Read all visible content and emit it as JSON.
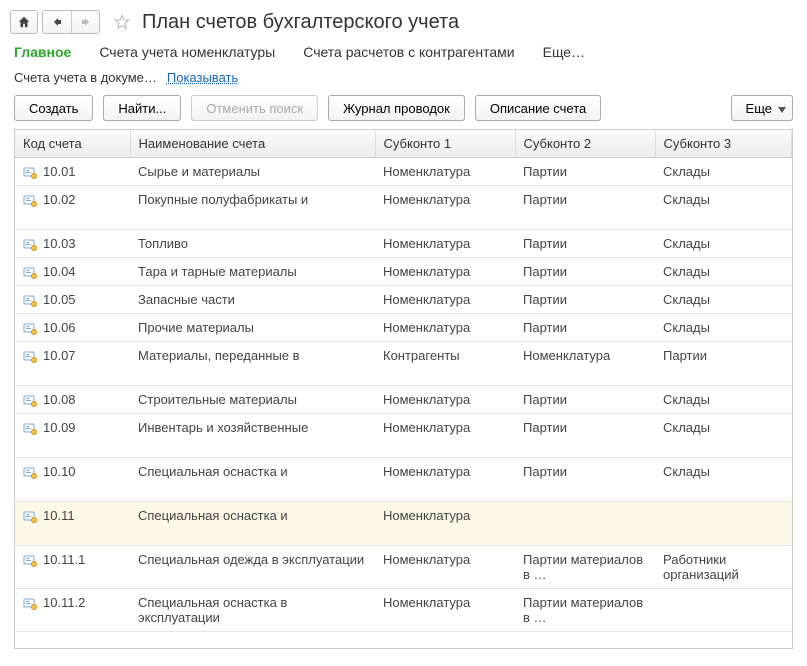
{
  "header": {
    "title": "План счетов бухгалтерского учета"
  },
  "tabs": {
    "main": "Главное",
    "nomenclature": "Счета учета номенклатуры",
    "contractors": "Счета расчетов с контрагентами",
    "more": "Еще…"
  },
  "filter": {
    "label": "Счета учета в докуме…",
    "link": "Показывать"
  },
  "toolbar": {
    "create": "Создать",
    "find": "Найти...",
    "cancel_search": "Отменить поиск",
    "journal": "Журнал проводок",
    "description": "Описание счета",
    "more": "Еще"
  },
  "columns": {
    "code": "Код счета",
    "name": "Наименование счета",
    "s1": "Субконто 1",
    "s2": "Субконто 2",
    "s3": "Субконто 3"
  },
  "rows": [
    {
      "code": "10.01",
      "name": "Сырье и материалы",
      "s1": "Номенклатура",
      "s2": "Партии",
      "s3": "Склады",
      "tall": false,
      "sel": false
    },
    {
      "code": "10.02",
      "name": "Покупные полуфабрикаты и",
      "s1": "Номенклатура",
      "s2": "Партии",
      "s3": "Склады",
      "tall": true,
      "sel": false
    },
    {
      "code": "10.03",
      "name": "Топливо",
      "s1": "Номенклатура",
      "s2": "Партии",
      "s3": "Склады",
      "tall": false,
      "sel": false
    },
    {
      "code": "10.04",
      "name": "Тара и тарные материалы",
      "s1": "Номенклатура",
      "s2": "Партии",
      "s3": "Склады",
      "tall": false,
      "sel": false
    },
    {
      "code": "10.05",
      "name": "Запасные части",
      "s1": "Номенклатура",
      "s2": "Партии",
      "s3": "Склады",
      "tall": false,
      "sel": false
    },
    {
      "code": "10.06",
      "name": "Прочие материалы",
      "s1": "Номенклатура",
      "s2": "Партии",
      "s3": "Склады",
      "tall": false,
      "sel": false
    },
    {
      "code": "10.07",
      "name": "Материалы, переданные в",
      "s1": "Контрагенты",
      "s2": "Номенклатура",
      "s3": "Партии",
      "tall": true,
      "sel": false
    },
    {
      "code": "10.08",
      "name": "Строительные материалы",
      "s1": "Номенклатура",
      "s2": "Партии",
      "s3": "Склады",
      "tall": false,
      "sel": false
    },
    {
      "code": "10.09",
      "name": "Инвентарь и хозяйственные",
      "s1": "Номенклатура",
      "s2": "Партии",
      "s3": "Склады",
      "tall": true,
      "sel": false
    },
    {
      "code": "10.10",
      "name": "Специальная оснастка и",
      "s1": "Номенклатура",
      "s2": "Партии",
      "s3": "Склады",
      "tall": true,
      "sel": false
    },
    {
      "code": "10.11",
      "name": "Специальная оснастка и",
      "s1": "Номенклатура",
      "s2": "",
      "s3": "",
      "tall": true,
      "sel": true
    },
    {
      "code": "10.11.1",
      "name": "Специальная одежда в эксплуатации",
      "s1": "Номенклатура",
      "s2": "Партии материалов в …",
      "s3": "Работники организаций",
      "tall": false,
      "sel": false
    },
    {
      "code": "10.11.2",
      "name": "Специальная оснастка в эксплуатации",
      "s1": "Номенклатура",
      "s2": "Партии материалов в …",
      "s3": "",
      "tall": false,
      "sel": false
    }
  ]
}
